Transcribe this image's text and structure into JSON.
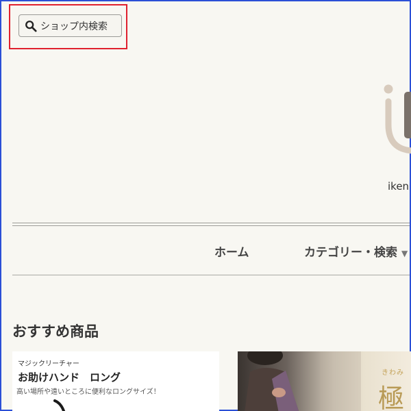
{
  "shop_search": {
    "label": "ショップ内検索",
    "icon": "search-icon"
  },
  "logo": {
    "text": "iken",
    "colors": {
      "ring": "#d8cbbd",
      "bar": "#7a716a"
    }
  },
  "nav": {
    "items": [
      {
        "label": "ホーム"
      },
      {
        "label": "カテゴリー・検索"
      }
    ]
  },
  "recommended": {
    "title": "おすすめ商品",
    "products": [
      {
        "brand": "マジックリーチャー",
        "name": "お助けハンド　ロング",
        "description": "高い場所や遠いところに便利なロングサイズ！"
      },
      {
        "ruby": "きわみ",
        "kanji": "極"
      }
    ]
  },
  "colors": {
    "highlight": "#e0202e",
    "frame": "#2b4fd6",
    "background": "#f8f7f2"
  }
}
